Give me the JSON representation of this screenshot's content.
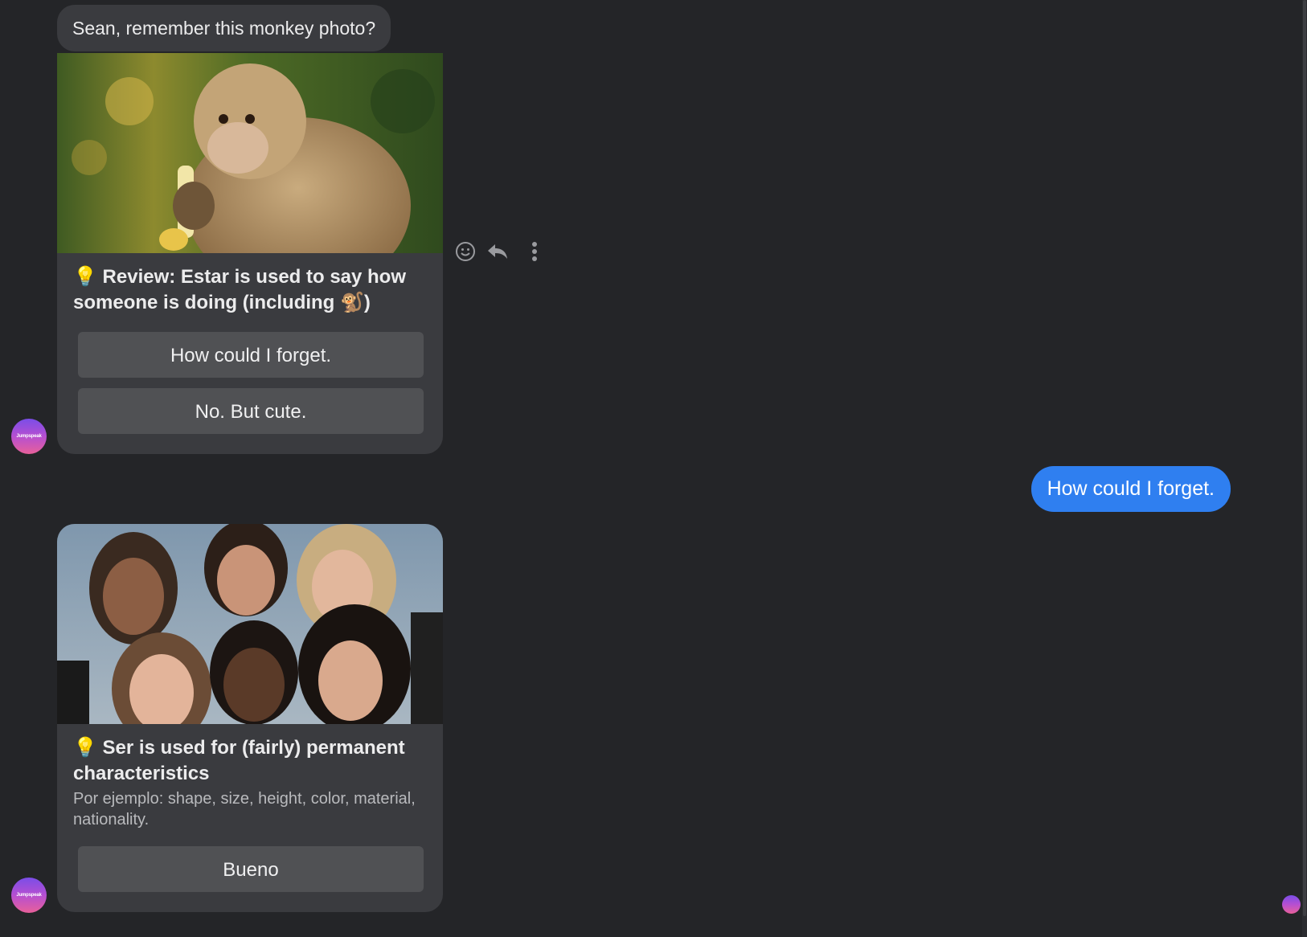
{
  "messages": {
    "intro_text": "Sean, remember this monkey photo?",
    "card1": {
      "image_icon": "monkey-photo",
      "title": "💡 Review: Estar is used to say how someone is doing (including 🐒)",
      "options": [
        "How could I forget.",
        "No. But cute."
      ]
    },
    "user_reply": "How could I forget.",
    "card2": {
      "image_icon": "group-photo",
      "title": "💡 Ser is used for (fairly) permanent characteristics",
      "subtitle": "Por ejemplo: shape, size, height, color, material, nationality.",
      "options": [
        "Bueno"
      ]
    }
  },
  "avatar": {
    "label": "Jumpspeak"
  },
  "message_actions": [
    "emoji-icon",
    "reply-icon",
    "more-vertical-icon"
  ],
  "colors": {
    "background": "#242528",
    "bot_bubble": "#3a3b3f",
    "option_button": "#505154",
    "user_bubble": "#2f7ff0"
  }
}
